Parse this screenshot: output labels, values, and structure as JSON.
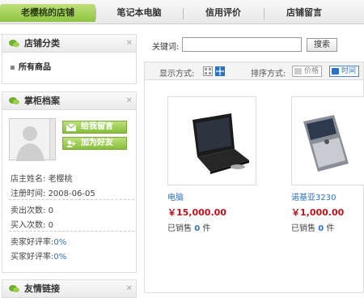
{
  "nav": {
    "tabs": [
      {
        "label": "老樱桃的店铺",
        "active": true
      },
      {
        "label": "笔记本电脑",
        "active": false
      },
      {
        "label": "信用评价",
        "active": false
      },
      {
        "label": "店铺留言",
        "active": false
      }
    ]
  },
  "sidebar": {
    "category": {
      "title": "店铺分类",
      "items": [
        "所有商品"
      ]
    },
    "profile": {
      "title": "掌柜档案",
      "message_button": "给我留言",
      "friend_button": "加为好友",
      "shop_name_label": "店主姓名:",
      "shop_name": "老樱桃",
      "reg_label": "注册时间:",
      "reg_date": "2008-06-05",
      "sell_label": "卖出次数:",
      "sell_count": "0",
      "buy_label": "买入次数:",
      "buy_count": "0",
      "seller_rate_label": "卖家好评率:",
      "seller_rate": "0%",
      "buyer_rate_label": "买家好评率:",
      "buyer_rate": "0%"
    },
    "links": {
      "title": "友情链接"
    }
  },
  "search": {
    "label": "关键词:",
    "value": "",
    "button": "搜索"
  },
  "toolbar": {
    "display_label": "显示方式:",
    "sort_label": "排序方式:",
    "sort_price": "价格",
    "sort_time": "时间"
  },
  "products": [
    {
      "name": "电脑",
      "price": "￥15,000.00",
      "sold_prefix": "已销售",
      "sold": "0",
      "sold_unit": "件"
    },
    {
      "name": "诺基亚3230",
      "price": "￥1,000.00",
      "sold_prefix": "已销售",
      "sold": "0",
      "sold_unit": "件"
    }
  ],
  "colors": {
    "accent_green": "#8cc43e",
    "link_blue": "#2a73c2",
    "price_red": "#c0101a"
  }
}
